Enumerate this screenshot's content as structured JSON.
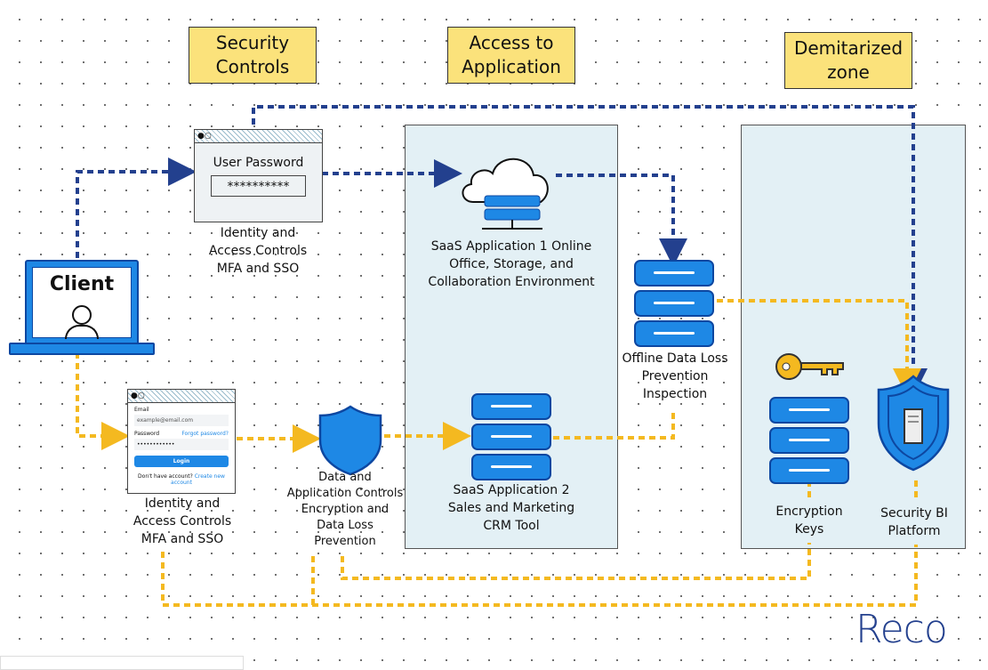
{
  "headers": {
    "security_controls": "Security Controls",
    "access_to_application": "Access to Application",
    "demilitarized_zone": "Demitarized zone"
  },
  "client": {
    "label": "Client"
  },
  "password_box": {
    "title": "User Password",
    "value": "**********",
    "caption": "Identity and Access Controls MFA and SSO"
  },
  "login_box": {
    "email_label": "Email",
    "email_placeholder": "example@email.com",
    "password_label": "Password",
    "forgot": "Forgot password?",
    "password_value": "••••••••••••",
    "login_button": "Login",
    "no_account": "Don't have account?",
    "create_account": "Create new account",
    "caption": "Identity and Access Controls MFA and SSO"
  },
  "shield_caption": "Data and Application Controls Encryption and Data Loss Prevention",
  "saas1": "SaaS Application 1 Online Office, Storage, and Collaboration Environment",
  "saas2": "SaaS Application 2 Sales and Marketing CRM Tool",
  "dlp": "Offline Data Loss Prevention Inspection",
  "encryption_keys": "Encryption Keys",
  "security_bi": "Security BI Platform",
  "logo": "Reco",
  "colors": {
    "blue_flow": "#23408e",
    "yellow_flow": "#f4b920",
    "label_bg": "#fbe27b",
    "icon_blue": "#1e88e5"
  }
}
